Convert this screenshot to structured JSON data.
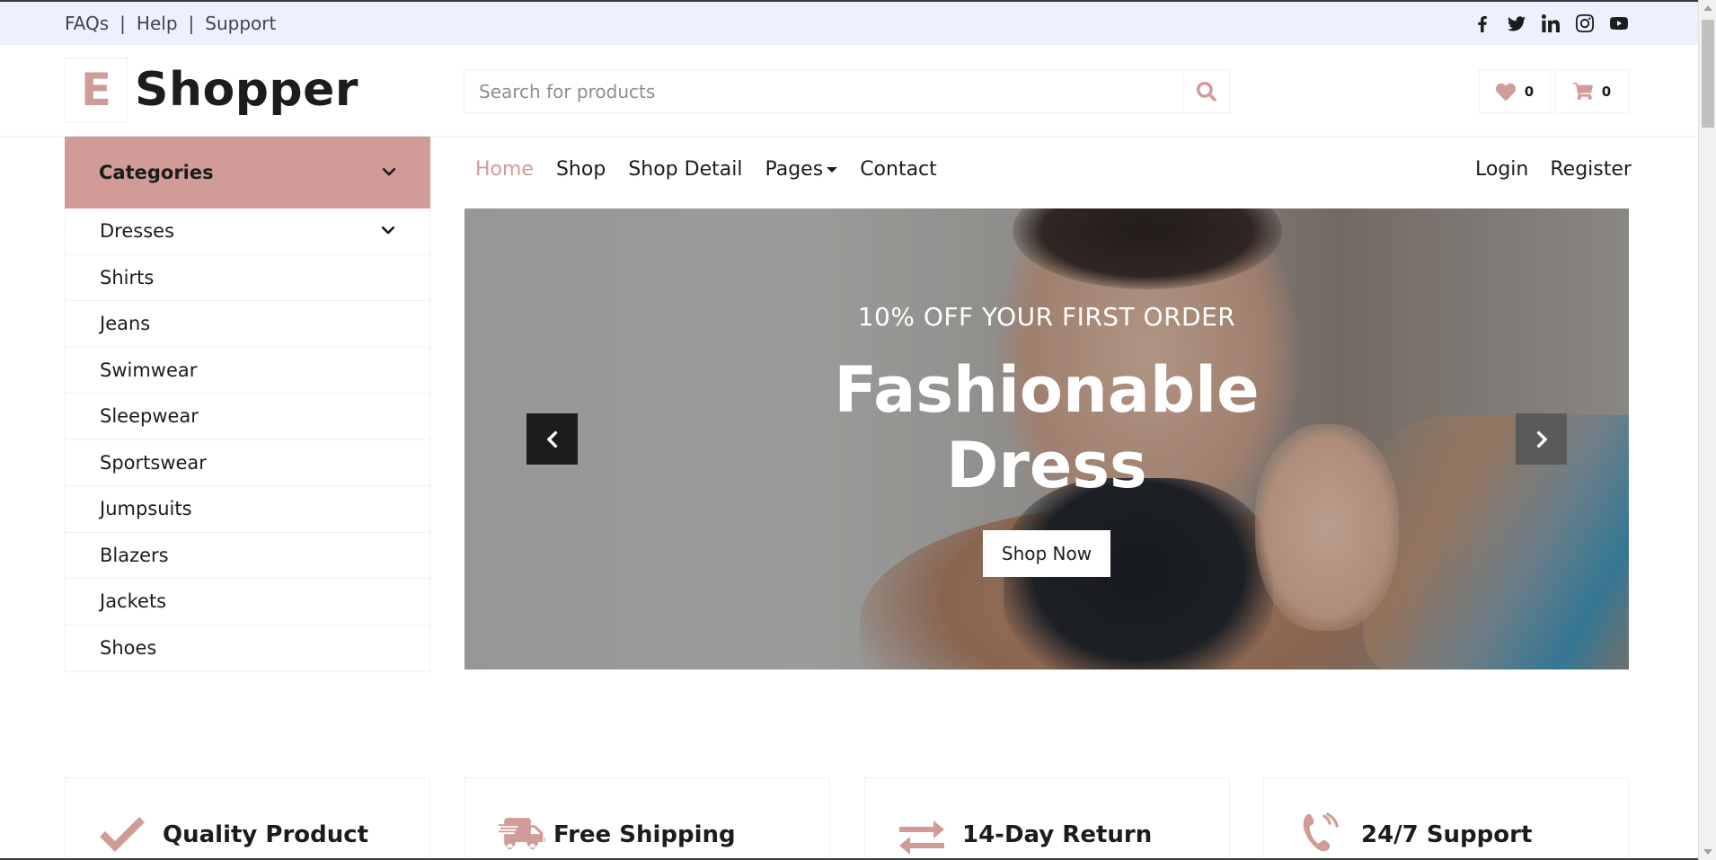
{
  "topbar": {
    "links": [
      "FAQs",
      "Help",
      "Support"
    ],
    "separator": "|",
    "socials": [
      "facebook-icon",
      "twitter-icon",
      "linkedin-icon",
      "instagram-icon",
      "youtube-icon"
    ]
  },
  "header": {
    "logo_letter": "E",
    "logo_text": "Shopper",
    "search_placeholder": "Search for products",
    "wishlist_count": "0",
    "cart_count": "0"
  },
  "sidebar": {
    "title": "Categories",
    "items": [
      {
        "label": "Dresses",
        "has_submenu": true
      },
      {
        "label": "Shirts"
      },
      {
        "label": "Jeans"
      },
      {
        "label": "Swimwear"
      },
      {
        "label": "Sleepwear"
      },
      {
        "label": "Sportswear"
      },
      {
        "label": "Jumpsuits"
      },
      {
        "label": "Blazers"
      },
      {
        "label": "Jackets"
      },
      {
        "label": "Shoes"
      }
    ]
  },
  "nav": {
    "items": [
      {
        "label": "Home",
        "active": true
      },
      {
        "label": "Shop"
      },
      {
        "label": "Shop Detail"
      },
      {
        "label": "Pages",
        "dropdown": true
      },
      {
        "label": "Contact"
      }
    ],
    "login": "Login",
    "register": "Register"
  },
  "hero": {
    "subtitle": "10% OFF YOUR FIRST ORDER",
    "title_line1": "Fashionable",
    "title_line2": "Dress",
    "button": "Shop Now"
  },
  "features": [
    {
      "icon": "check-icon",
      "label": "Quality Product"
    },
    {
      "icon": "shipping-fast-icon",
      "label": "Free Shipping"
    },
    {
      "icon": "exchange-icon",
      "label": "14-Day Return"
    },
    {
      "icon": "phone-volume-icon",
      "label": "24/7 Support"
    }
  ],
  "colors": {
    "accent": "#d19c97",
    "topbar_bg": "#edf1ff",
    "text": "#1c1c1c"
  }
}
